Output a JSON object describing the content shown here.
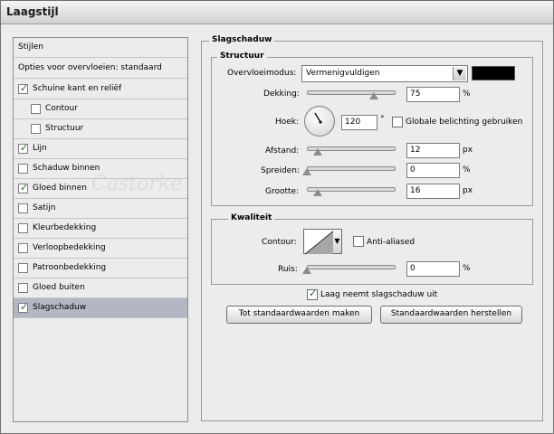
{
  "window": {
    "title": "Laagstijl"
  },
  "style_list": {
    "header": "Stijlen",
    "blending_options": "Opties voor overvloeien: standaard",
    "items": [
      {
        "label": "Schuine kant en reliëf",
        "checked": true,
        "indent": false
      },
      {
        "label": "Contour",
        "checked": false,
        "indent": true
      },
      {
        "label": "Structuur",
        "checked": false,
        "indent": true
      },
      {
        "label": "Lijn",
        "checked": true,
        "indent": false
      },
      {
        "label": "Schaduw binnen",
        "checked": false,
        "indent": false
      },
      {
        "label": "Gloed binnen",
        "checked": true,
        "indent": false
      },
      {
        "label": "Satijn",
        "checked": false,
        "indent": false
      },
      {
        "label": "Kleurbedekking",
        "checked": false,
        "indent": false
      },
      {
        "label": "Verloopbedekking",
        "checked": false,
        "indent": false
      },
      {
        "label": "Patroonbedekking",
        "checked": false,
        "indent": false
      },
      {
        "label": "Gloed buiten",
        "checked": false,
        "indent": false
      },
      {
        "label": "Slagschaduw",
        "checked": true,
        "indent": false,
        "selected": true
      }
    ]
  },
  "panel": {
    "title": "Slagschaduw",
    "structure": {
      "title": "Structuur",
      "blend_mode_label": "Overvloeimodus:",
      "blend_mode_value": "Vermenigvuldigen",
      "shadow_color": "#000000",
      "opacity_label": "Dekking:",
      "opacity_value": "75",
      "opacity_unit": "%",
      "angle_label": "Hoek:",
      "angle_value": "120",
      "angle_unit": "°",
      "global_light_label": "Globale belichting gebruiken",
      "global_light_checked": false,
      "distance_label": "Afstand:",
      "distance_value": "12",
      "distance_unit": "px",
      "spread_label": "Spreiden:",
      "spread_value": "0",
      "spread_unit": "%",
      "size_label": "Grootte:",
      "size_value": "16",
      "size_unit": "px"
    },
    "quality": {
      "title": "Kwaliteit",
      "contour_label": "Contour:",
      "anti_aliased_label": "Anti-aliased",
      "anti_aliased_checked": false,
      "noise_label": "Ruis:",
      "noise_value": "0",
      "noise_unit": "%"
    },
    "knockout_label": "Laag neemt slagschaduw uit",
    "knockout_checked": true,
    "make_default_button": "Tot standaardwaarden maken",
    "reset_default_button": "Standaardwaarden herstellen"
  },
  "watermark": "Castorke"
}
